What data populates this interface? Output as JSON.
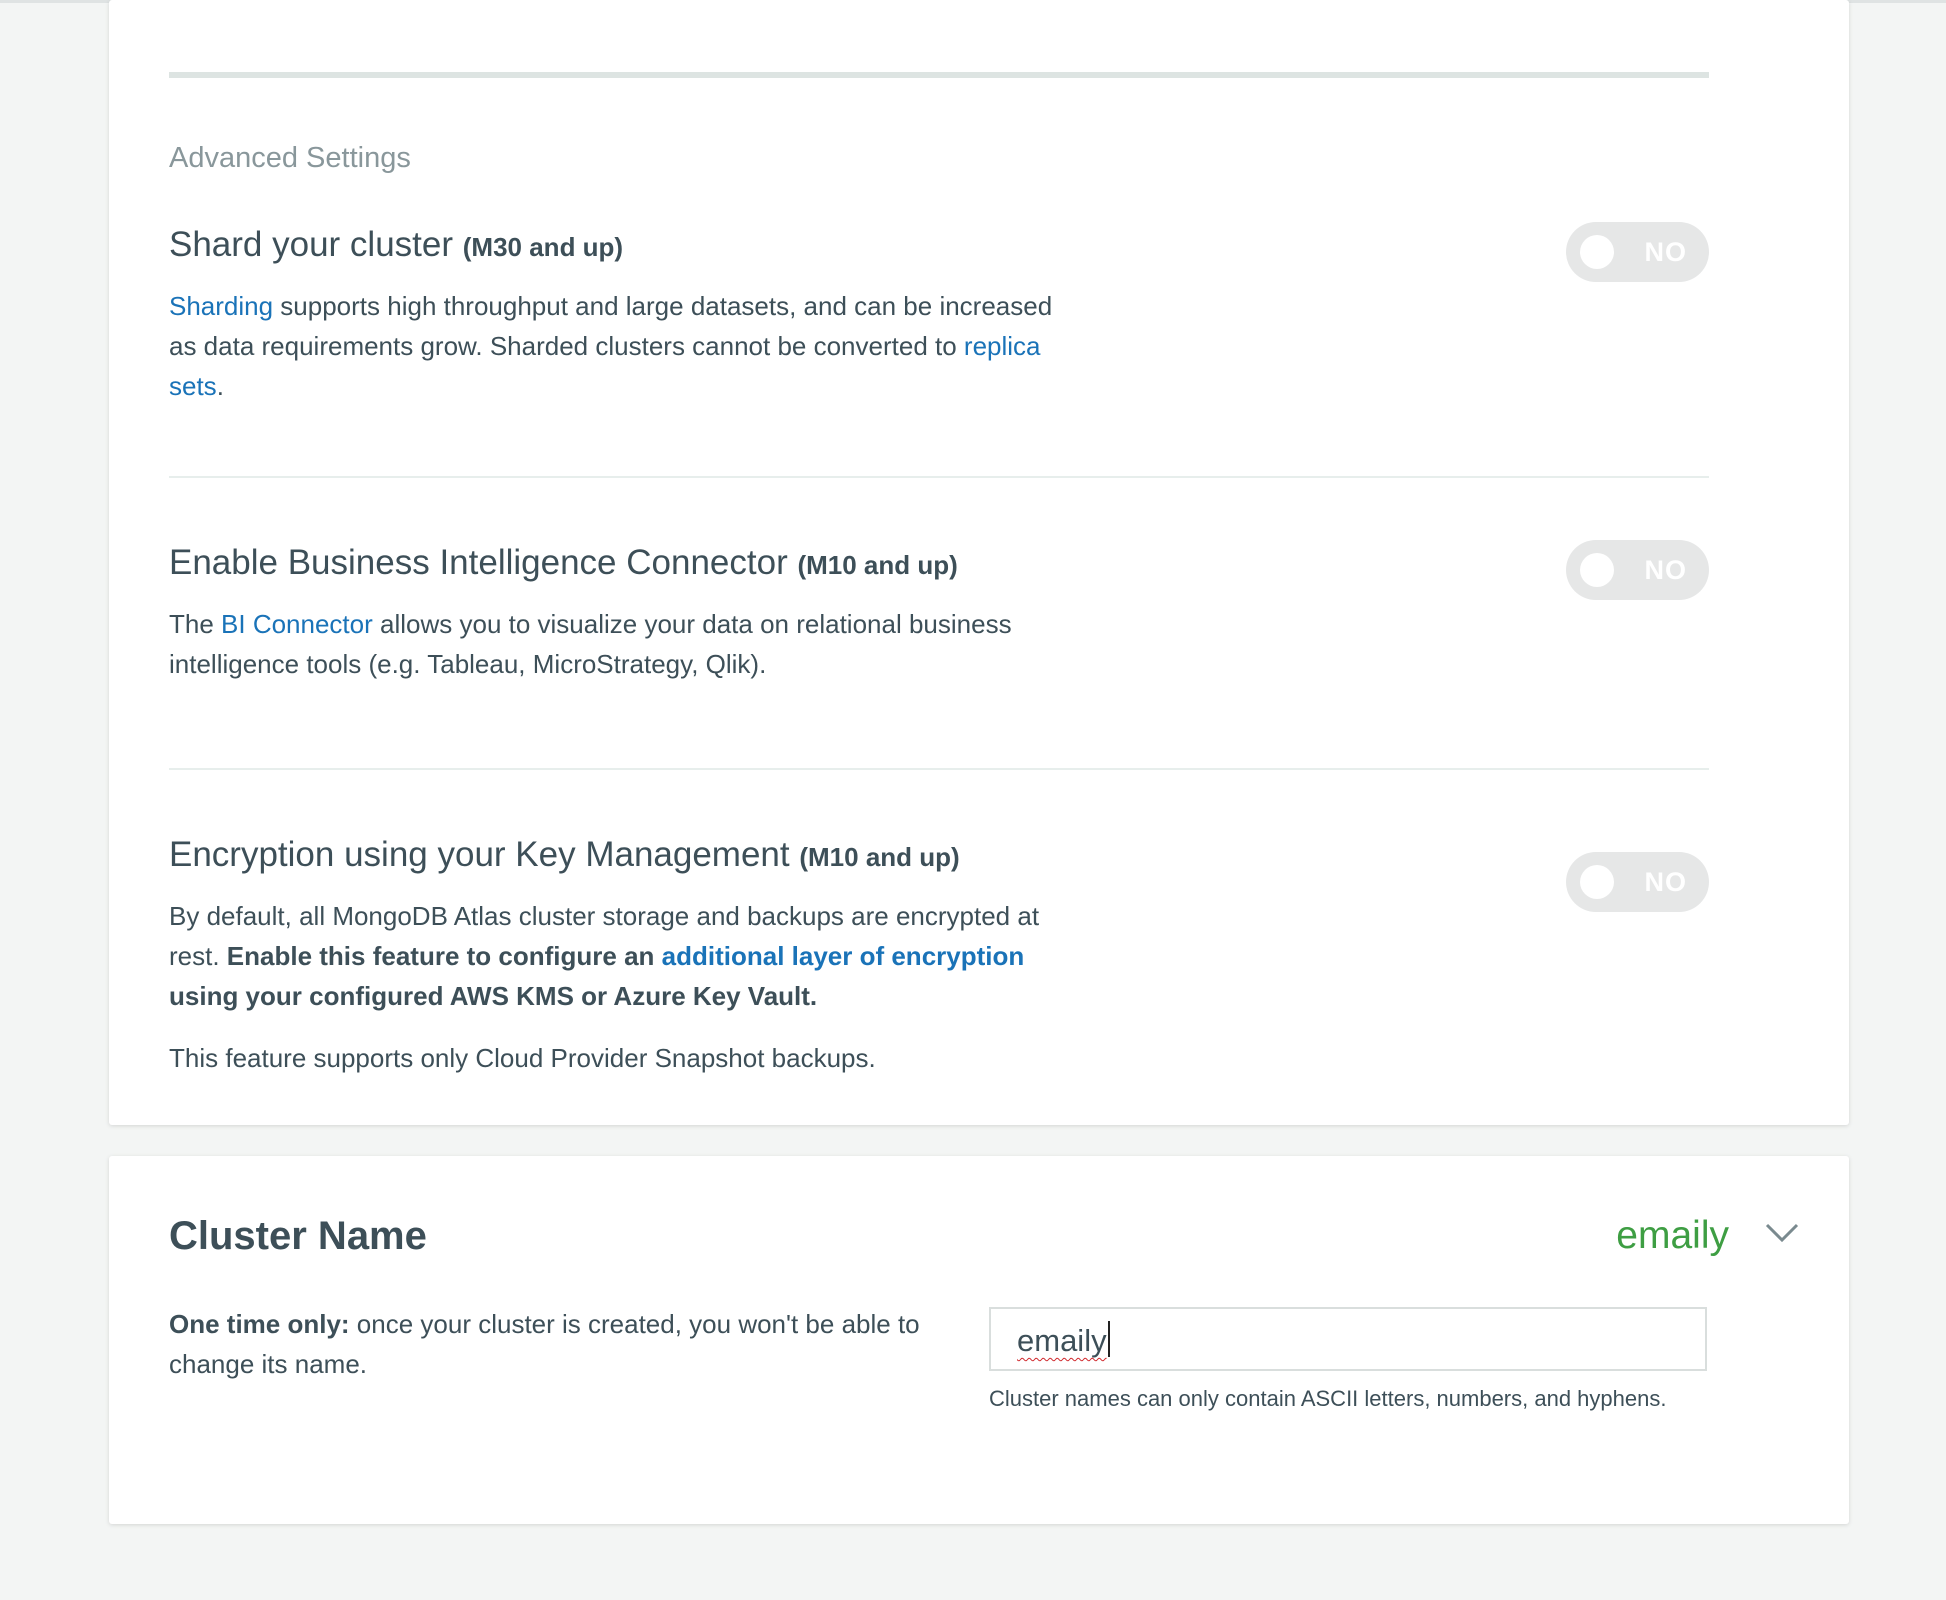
{
  "advanced": {
    "heading": "Advanced Settings",
    "settings": [
      {
        "title": "Shard your cluster",
        "tier": "(M30 and up)",
        "toggle": "NO",
        "desc": {
          "link1": "Sharding",
          "text1": " supports high throughput and large datasets, and can be increased as data requirements grow. Sharded clusters cannot be converted to ",
          "link2": "replica sets",
          "text2": "."
        }
      },
      {
        "title": "Enable Business Intelligence Connector",
        "tier": "(M10 and up)",
        "toggle": "NO",
        "desc": {
          "text0": "The ",
          "link1": "BI Connector",
          "text1": " allows you to visualize your data on relational business intelligence tools (e.g. Tableau, MicroStrategy, Qlik)."
        }
      },
      {
        "title": "Encryption using your Key Management",
        "tier": "(M10 and up)",
        "toggle": "NO",
        "desc": {
          "text0": "By default, all MongoDB Atlas cluster storage and backups are encrypted at rest. ",
          "bold1": "Enable this feature to configure an ",
          "link1": "additional layer of encryption",
          "bold2": " using your configured AWS KMS or Azure Key Vault."
        },
        "note": "This feature supports only Cloud Provider Snapshot backups."
      }
    ]
  },
  "cluster_name": {
    "title": "Cluster Name",
    "value": "emaily",
    "desc_bold": "One time only:",
    "desc_text": " once your cluster is created, you won't be able to change its name.",
    "input_value": "emaily",
    "help": "Cluster names can only contain ASCII letters, numbers, and hyphens."
  }
}
